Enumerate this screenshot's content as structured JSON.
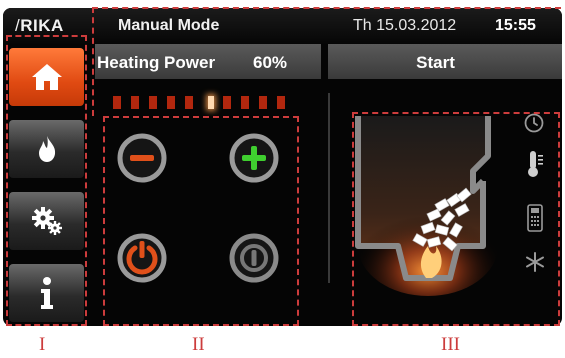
{
  "header": {
    "logo": "RIKA",
    "mode_title": "Manual Mode",
    "date": "Th 15.03.2012",
    "time": "15:55"
  },
  "sidebar": {
    "items": [
      {
        "icon": "home-icon",
        "active": true
      },
      {
        "icon": "flame-icon",
        "active": false
      },
      {
        "icon": "settings-gears-icon",
        "active": false
      },
      {
        "icon": "info-icon",
        "active": false
      }
    ]
  },
  "heating": {
    "label": "Heating Power",
    "value": "60%",
    "level": 0.6,
    "segments": 10,
    "lit_segment": 6
  },
  "controls": {
    "minus_icon": "minus-circle-icon",
    "plus_icon": "plus-circle-icon",
    "power_icon": "power-icon",
    "standby_icon": "standby-icon"
  },
  "status": {
    "label": "Start",
    "indicators": [
      "clock-icon",
      "thermometer-icon",
      "remote-control-icon",
      "snowflake-icon"
    ]
  },
  "annotations": {
    "region_1": "I",
    "region_2": "II",
    "region_3": "III"
  },
  "colors": {
    "accent_orange": "#e0501a",
    "plus_green": "#3fcf2f",
    "annotation_red": "#cc3c3c",
    "segment_red": "#b2270e"
  }
}
